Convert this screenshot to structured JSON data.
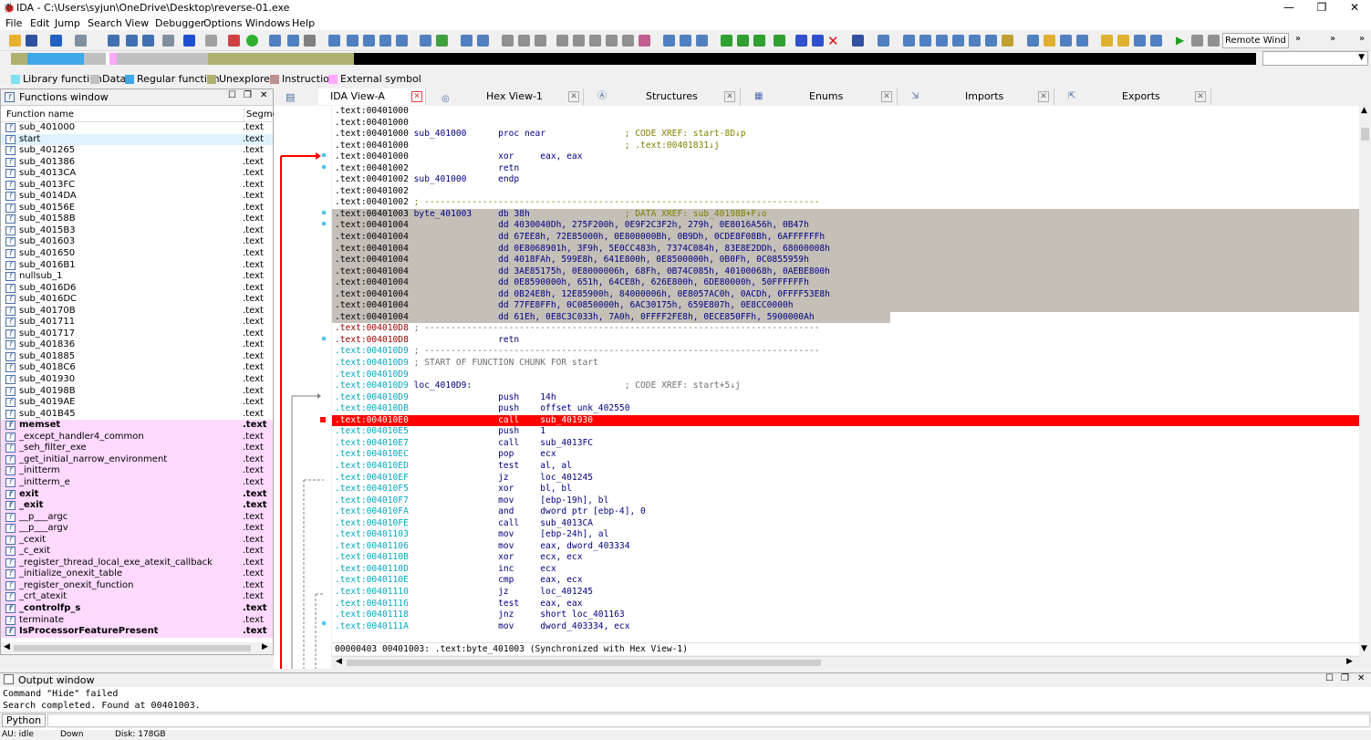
{
  "window": {
    "title": "IDA - C:\\Users\\syjun\\OneDrive\\Desktop\\reverse-01.exe",
    "minimize": "—",
    "maximize": "❐",
    "close": "✕"
  },
  "menu": [
    "File",
    "Edit",
    "Jump",
    "Search",
    "View",
    "Debugger",
    "Options",
    "Windows",
    "Help"
  ],
  "toolbar": {
    "debugger_select": "Remote Wind"
  },
  "legend": [
    {
      "label": "Library function",
      "color": "#7fe0f0"
    },
    {
      "label": "Data",
      "color": "#c0c0c0"
    },
    {
      "label": "Regular function",
      "color": "#3fa8e8"
    },
    {
      "label": "Unexplored",
      "color": "#b0b070"
    },
    {
      "label": "Instruction",
      "color": "#c09090"
    },
    {
      "label": "External symbol",
      "color": "#ffa8ff"
    }
  ],
  "functions_window": {
    "title": "Functions window",
    "col_name": "Function name",
    "col_segment": "Segme",
    "rows": [
      {
        "name": "sub_401000",
        "seg": ".text",
        "style": ""
      },
      {
        "name": "start",
        "seg": ".text",
        "style": "sel"
      },
      {
        "name": "sub_401265",
        "seg": ".text",
        "style": ""
      },
      {
        "name": "sub_401386",
        "seg": ".text",
        "style": ""
      },
      {
        "name": "sub_4013CA",
        "seg": ".text",
        "style": ""
      },
      {
        "name": "sub_4013FC",
        "seg": ".text",
        "style": ""
      },
      {
        "name": "sub_4014DA",
        "seg": ".text",
        "style": ""
      },
      {
        "name": "sub_40156E",
        "seg": ".text",
        "style": ""
      },
      {
        "name": "sub_40158B",
        "seg": ".text",
        "style": ""
      },
      {
        "name": "sub_4015B3",
        "seg": ".text",
        "style": ""
      },
      {
        "name": "sub_401603",
        "seg": ".text",
        "style": ""
      },
      {
        "name": "sub_401650",
        "seg": ".text",
        "style": ""
      },
      {
        "name": "sub_4016B1",
        "seg": ".text",
        "style": ""
      },
      {
        "name": "nullsub_1",
        "seg": ".text",
        "style": ""
      },
      {
        "name": "sub_4016D6",
        "seg": ".text",
        "style": ""
      },
      {
        "name": "sub_4016DC",
        "seg": ".text",
        "style": ""
      },
      {
        "name": "sub_40170B",
        "seg": ".text",
        "style": ""
      },
      {
        "name": "sub_401711",
        "seg": ".text",
        "style": ""
      },
      {
        "name": "sub_401717",
        "seg": ".text",
        "style": ""
      },
      {
        "name": "sub_401836",
        "seg": ".text",
        "style": ""
      },
      {
        "name": "sub_401885",
        "seg": ".text",
        "style": ""
      },
      {
        "name": "sub_4018C6",
        "seg": ".text",
        "style": ""
      },
      {
        "name": "sub_401930",
        "seg": ".text",
        "style": ""
      },
      {
        "name": "sub_40198B",
        "seg": ".text",
        "style": ""
      },
      {
        "name": "sub_4019AE",
        "seg": ".text",
        "style": ""
      },
      {
        "name": "sub_401B45",
        "seg": ".text",
        "style": ""
      },
      {
        "name": "memset",
        "seg": ".text",
        "style": "lib bold"
      },
      {
        "name": "_except_handler4_common",
        "seg": ".text",
        "style": "lib"
      },
      {
        "name": "_seh_filter_exe",
        "seg": ".text",
        "style": "lib"
      },
      {
        "name": "_get_initial_narrow_environment",
        "seg": ".text",
        "style": "lib"
      },
      {
        "name": "_initterm",
        "seg": ".text",
        "style": "lib"
      },
      {
        "name": "_initterm_e",
        "seg": ".text",
        "style": "lib"
      },
      {
        "name": "exit",
        "seg": ".text",
        "style": "lib bold"
      },
      {
        "name": "_exit",
        "seg": ".text",
        "style": "lib bold"
      },
      {
        "name": "__p___argc",
        "seg": ".text",
        "style": "lib"
      },
      {
        "name": "__p___argv",
        "seg": ".text",
        "style": "lib"
      },
      {
        "name": "_cexit",
        "seg": ".text",
        "style": "lib"
      },
      {
        "name": "_c_exit",
        "seg": ".text",
        "style": "lib"
      },
      {
        "name": "_register_thread_local_exe_atexit_callback",
        "seg": ".text",
        "style": "lib"
      },
      {
        "name": "_initialize_onexit_table",
        "seg": ".text",
        "style": "lib"
      },
      {
        "name": "_register_onexit_function",
        "seg": ".text",
        "style": "lib"
      },
      {
        "name": "_crt_atexit",
        "seg": ".text",
        "style": "lib"
      },
      {
        "name": "_controlfp_s",
        "seg": ".text",
        "style": "lib bold"
      },
      {
        "name": "terminate",
        "seg": ".text",
        "style": "lib"
      },
      {
        "name": "IsProcessorFeaturePresent",
        "seg": ".text",
        "style": "lib bold"
      }
    ]
  },
  "tabs": [
    {
      "label": "IDA View-A",
      "active": true
    },
    {
      "label": "Hex View-1",
      "active": false
    },
    {
      "label": "Structures",
      "active": false
    },
    {
      "label": "Enums",
      "active": false
    },
    {
      "label": "Imports",
      "active": false
    },
    {
      "label": "Exports",
      "active": false
    }
  ],
  "disasm": [
    {
      "a": ".text:00401000",
      "t": "",
      "c": "k"
    },
    {
      "a": ".text:00401000",
      "t": "",
      "c": "k"
    },
    {
      "a": ".text:00401000",
      "t": " sub_401000      proc near               ; CODE XREF: start-8D↓p",
      "c": "k"
    },
    {
      "a": ".text:00401000",
      "t": "                                         ; .text:00401831↓j",
      "c": "k"
    },
    {
      "a": ".text:00401000",
      "t": "                 xor     eax, eax",
      "c": "k"
    },
    {
      "a": ".text:00401002",
      "t": "                 retn",
      "c": "k"
    },
    {
      "a": ".text:00401002",
      "t": " sub_401000      endp",
      "c": "k"
    },
    {
      "a": ".text:00401002",
      "t": "",
      "c": "k"
    },
    {
      "a": ".text:00401002",
      "t": " ; ---------------------------------------------------------------------------",
      "c": "k"
    },
    {
      "a": ".text:00401003",
      "t": " byte_401003     db 38h                  ; DATA XREF: sub_40198B+F↓o",
      "c": "d"
    },
    {
      "a": ".text:00401004",
      "t": "                 dd 4030040Dh, 275F200h, 0E9F2C3F2h, 279h, 0E8016A56h, 0B47h",
      "c": "d"
    },
    {
      "a": ".text:00401004",
      "t": "                 dd 67EE8h, 72E85000h, 0E800000Bh, 0B9Dh, 0CDE8F08Bh, 6AFFFFFFh",
      "c": "d"
    },
    {
      "a": ".text:00401004",
      "t": "                 dd 0E8068901h, 3F9h, 5E0CC483h, 7374C084h, 83E8E2DDh, 68000008h",
      "c": "d"
    },
    {
      "a": ".text:00401004",
      "t": "                 dd 4018FAh, 599E8h, 641E800h, 0E8500000h, 0B0Fh, 0C0855959h",
      "c": "d"
    },
    {
      "a": ".text:00401004",
      "t": "                 dd 3AE85175h, 0E8000006h, 68Fh, 0B74C085h, 40100068h, 0AEBE800h",
      "c": "d"
    },
    {
      "a": ".text:00401004",
      "t": "                 dd 0E8590000h, 651h, 64CE8h, 626E800h, 6DE80000h, 50FFFFFFh",
      "c": "d"
    },
    {
      "a": ".text:00401004",
      "t": "                 dd 0B24E8h, 12E85900h, 84000006h, 0E8057AC0h, 0ACDh, 0FFFF53E8h",
      "c": "d"
    },
    {
      "a": ".text:00401004",
      "t": "                 dd 77FE8FFh, 0C0850000h, 6AC30175h, 659E807h, 0E8CC0000h",
      "c": "d"
    },
    {
      "a": ".text:00401004",
      "t": "                 dd 61Eh, 0E8C3C033h, 7A0h, 0FFFF2FE8h, 0ECE850FFh, 5900000Ah",
      "c": "d2"
    },
    {
      "a": ".text:004010D8",
      "t": " ; ---------------------------------------------------------------------------",
      "c": "r"
    },
    {
      "a": ".text:004010D8",
      "t": "                 retn",
      "c": "r"
    },
    {
      "a": ".text:004010D9",
      "t": " ; ---------------------------------------------------------------------------",
      "c": "c"
    },
    {
      "a": ".text:004010D9",
      "t": " ; START OF FUNCTION CHUNK FOR start",
      "c": "c"
    },
    {
      "a": ".text:004010D9",
      "t": "",
      "c": "c"
    },
    {
      "a": ".text:004010D9",
      "t": " loc_4010D9:                             ; CODE XREF: start+5↓j",
      "c": "c"
    },
    {
      "a": ".text:004010D9",
      "t": "                 push    14h",
      "c": "c"
    },
    {
      "a": ".text:004010DB",
      "t": "                 push    offset unk_402550",
      "c": "c"
    },
    {
      "a": ".text:004010E0",
      "t": "                 call    sub_401930",
      "c": "h"
    },
    {
      "a": ".text:004010E5",
      "t": "                 push    1",
      "c": "c"
    },
    {
      "a": ".text:004010E7",
      "t": "                 call    sub_4013FC",
      "c": "c"
    },
    {
      "a": ".text:004010EC",
      "t": "                 pop     ecx",
      "c": "c"
    },
    {
      "a": ".text:004010ED",
      "t": "                 test    al, al",
      "c": "c"
    },
    {
      "a": ".text:004010EF",
      "t": "                 jz      loc_401245",
      "c": "c"
    },
    {
      "a": ".text:004010F5",
      "t": "                 xor     bl, bl",
      "c": "c"
    },
    {
      "a": ".text:004010F7",
      "t": "                 mov     [ebp-19h], bl",
      "c": "c"
    },
    {
      "a": ".text:004010FA",
      "t": "                 and     dword ptr [ebp-4], 0",
      "c": "c"
    },
    {
      "a": ".text:004010FE",
      "t": "                 call    sub_4013CA",
      "c": "c"
    },
    {
      "a": ".text:00401103",
      "t": "                 mov     [ebp-24h], al",
      "c": "c"
    },
    {
      "a": ".text:00401106",
      "t": "                 mov     eax, dword_403334",
      "c": "c"
    },
    {
      "a": ".text:0040110B",
      "t": "                 xor     ecx, ecx",
      "c": "c"
    },
    {
      "a": ".text:0040110D",
      "t": "                 inc     ecx",
      "c": "c"
    },
    {
      "a": ".text:0040110E",
      "t": "                 cmp     eax, ecx",
      "c": "c"
    },
    {
      "a": ".text:00401110",
      "t": "                 jz      loc_401245",
      "c": "c"
    },
    {
      "a": ".text:00401116",
      "t": "                 test    eax, eax",
      "c": "c"
    },
    {
      "a": ".text:00401118",
      "t": "                 jnz     short loc_401163",
      "c": "c"
    },
    {
      "a": ".text:0040111A",
      "t": "                 mov     dword_403334, ecx",
      "c": "c"
    }
  ],
  "sync_line": "00000403 00401003: .text:byte_401003 (Synchronized with Hex View-1)",
  "output_window": {
    "title": "Output window",
    "lines": "Command \"Hide\" failed\nSearch completed. Found at 00401003."
  },
  "python_button": "Python",
  "status": {
    "au": "AU:  idle",
    "down": "Down",
    "disk": "Disk: 178GB"
  }
}
